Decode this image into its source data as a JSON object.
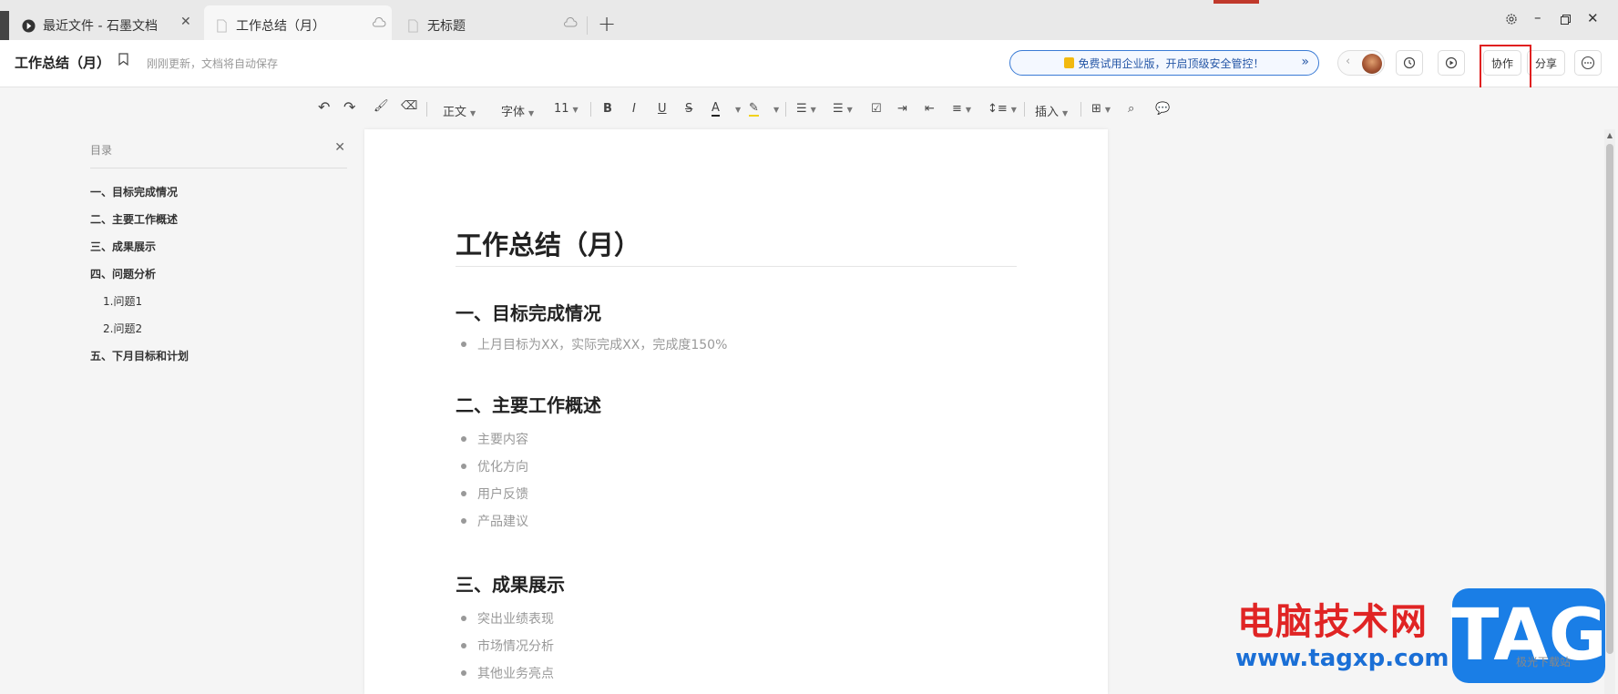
{
  "tabs": [
    {
      "label": "最近文件 - 石墨文档",
      "icon": "shimo-logo-icon"
    },
    {
      "label": "工作总结（月）",
      "icon": "document-icon"
    },
    {
      "label": "无标题",
      "icon": "document-icon"
    }
  ],
  "header": {
    "title": "工作总结（月）",
    "save_status": "刚刚更新，文档将自动保存",
    "promo": "免费试用企业版，开启顶级安全管控！",
    "collab_label": "协作",
    "share_label": "分享"
  },
  "toolbar": {
    "style_label": "正文",
    "font_label": "字体",
    "size_label": "11",
    "insert_label": "插入"
  },
  "outline": {
    "title": "目录",
    "items": [
      {
        "label": "一、目标完成情况",
        "level": 1
      },
      {
        "label": "二、主要工作概述",
        "level": 1
      },
      {
        "label": "三、成果展示",
        "level": 1
      },
      {
        "label": "四、问题分析",
        "level": 1
      },
      {
        "label": "1.问题1",
        "level": 2
      },
      {
        "label": "2.问题2",
        "level": 2
      },
      {
        "label": "五、下月目标和计划",
        "level": 1
      }
    ]
  },
  "document": {
    "title": "工作总结（月）",
    "sections": [
      {
        "heading": "一、目标完成情况",
        "items": [
          "上月目标为XX，实际完成XX，完成度150%"
        ]
      },
      {
        "heading": "二、主要工作概述",
        "items": [
          "主要内容",
          "优化方向",
          "用户反馈",
          "产品建议"
        ]
      },
      {
        "heading": "三、成果展示",
        "items": [
          "突出业绩表现",
          "市场情况分析",
          "其他业务亮点"
        ]
      }
    ]
  },
  "watermark": {
    "text": "电脑技术网",
    "url": "www.tagxp.com",
    "tag": "TAG",
    "sub": "极光下载站"
  },
  "colors": {
    "accent_blue": "#3a7bd5",
    "highlight_red": "#e02020",
    "text_dark": "#222222",
    "list_gray": "#999999"
  }
}
